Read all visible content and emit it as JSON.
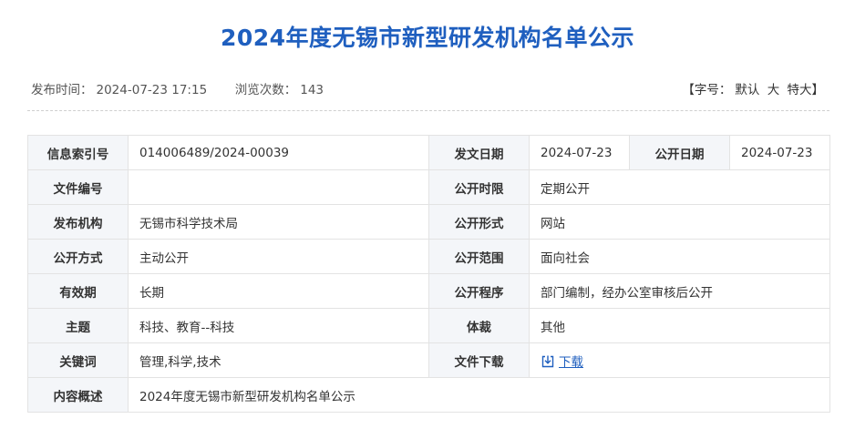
{
  "header": {
    "title": "2024年度无锡市新型研发机构名单公示",
    "publish_time_label": "发布时间：",
    "publish_time": "2024-07-23 17:15",
    "views_label": "浏览次数：",
    "views": "143",
    "font_size_label": "【字号：",
    "font_size_options": [
      "默认",
      "大",
      "特大"
    ],
    "font_size_close": "】"
  },
  "info": {
    "index_no_label": "信息索引号",
    "index_no": "014006489/2024-00039",
    "doc_date_label": "发文日期",
    "doc_date": "2024-07-23",
    "public_date_label": "公开日期",
    "public_date": "2024-07-23",
    "doc_number_label": "文件编号",
    "doc_number": "",
    "time_limit_label": "公开时限",
    "time_limit": "定期公开",
    "issuer_label": "发布机构",
    "issuer": "无锡市科学技术局",
    "form_label": "公开形式",
    "form": "网站",
    "method_label": "公开方式",
    "method": "主动公开",
    "scope_label": "公开范围",
    "scope": "面向社会",
    "validity_label": "有效期",
    "validity": "长期",
    "procedure_label": "公开程序",
    "procedure": "部门编制，经办公室审核后公开",
    "topic_label": "主题",
    "topic": "科技、教育--科技",
    "genre_label": "体裁",
    "genre": "其他",
    "keywords_label": "关键词",
    "keywords": "管理,科学,技术",
    "download_label": "文件下载",
    "download_link": "下载",
    "summary_label": "内容概述",
    "summary": "2024年度无锡市新型研发机构名单公示"
  },
  "colors": {
    "title": "#1f5fbf",
    "label_bg": "#f4f6f9",
    "border": "#e3e3e3",
    "link": "#1f5fbf"
  }
}
